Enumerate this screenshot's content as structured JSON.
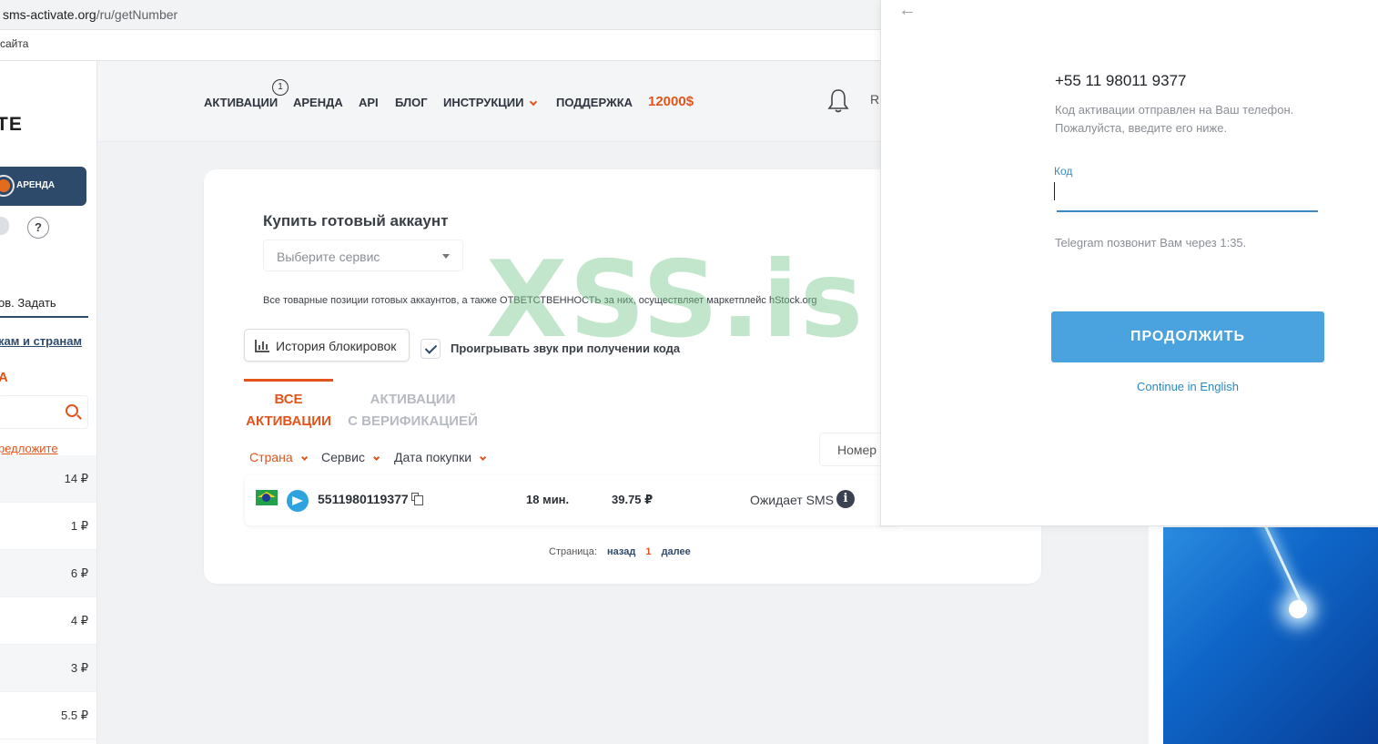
{
  "browser": {
    "url_host": "sms-activate.org",
    "url_path": "/ru/getNumber",
    "bookmark": "сайта"
  },
  "sidebar": {
    "logo": "TE",
    "rent_label": "АРЕНДА",
    "help": "?",
    "set_input": "ов. Задать",
    "filter_link": "кам и странам",
    "red_letter": "А",
    "suggest": "редложите",
    "prices": [
      "14 ₽",
      "1 ₽",
      "6 ₽",
      "4 ₽",
      "3 ₽",
      "5.5 ₽"
    ]
  },
  "nav": {
    "activations": "АКТИВАЦИИ",
    "activations_badge": "1",
    "rent": "АРЕНДА",
    "api": "API",
    "blog": "БЛОГ",
    "instructions": "ИНСТРУКЦИИ",
    "support": "ПОДДЕРЖКА",
    "bonus": "12000$",
    "lang": "R"
  },
  "main": {
    "buy_title": "Купить готовый аккаунт",
    "service_placeholder": "Выберите сервис",
    "disclaimer": "Все товарные позиции готовых аккаунтов, а также ОТВЕТСТВЕННОСТЬ за них, осуществляет маркетплейс hStock.org",
    "history_btn": "История блокировок",
    "sound_label": "Проигрывать звук при получении кода",
    "tab_all_1": "ВСЕ",
    "tab_all_2": "АКТИВАЦИИ",
    "tab_verif_1": "АКТИВАЦИИ",
    "tab_verif_2": "С ВЕРИФИКАЦИЕЙ",
    "filter_country": "Страна",
    "filter_service": "Сервис",
    "filter_date": "Дата покупки",
    "number_search": "Номер",
    "row": {
      "phone": "5511980119377",
      "time": "18 мин.",
      "price": "39.75 ₽",
      "status": "Ожидает SMS",
      "info": "i"
    },
    "pager_label": "Страница:",
    "pager_back": "назад",
    "pager_current": "1",
    "pager_next": "далее"
  },
  "watermark": "XSS.is",
  "popup": {
    "phone": "+55 11 98011 9377",
    "desc": "Код активации отправлен на Ваш телефон. Пожалуйста, введите его ниже.",
    "code_label": "Код",
    "code_value": "",
    "call_text": "Telegram позвонит Вам через 1:35.",
    "continue_btn": "ПРОДОЛЖИТЬ",
    "english_link": "Continue in English"
  },
  "colors": {
    "accent": "#e2541b",
    "navy": "#2e4a6b",
    "telegram_blue": "#4aa3df"
  }
}
